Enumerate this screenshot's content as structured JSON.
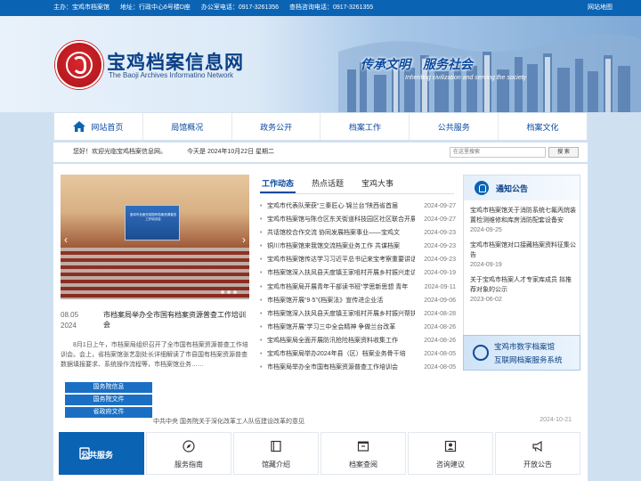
{
  "topbar": {
    "host": "主办：宝鸡市档案馆",
    "address": "地址：行政中心6号楼D座",
    "office_phone": "办公室电话：0917-3261356",
    "query_phone": "查档咨询电话：0917-3261355",
    "sitemap": "网站地图"
  },
  "header": {
    "logo_title": "宝鸡档案信息网",
    "logo_subtitle": "The Baoji Archives Informatino Network",
    "slogan": "传承文明　服务社会",
    "slogan_en": "Inheriting civilization and serving the society"
  },
  "nav": {
    "items": [
      "网站首页",
      "局馆概况",
      "政务公开",
      "档案工作",
      "公共服务",
      "档案文化"
    ]
  },
  "status": {
    "welcome": "您好！欢迎光临宝鸡档案信息网。",
    "today": "今天是 2024年10月22日 星期二",
    "search_placeholder": "在这里搜索",
    "search_button": "搜 索"
  },
  "featured": {
    "stage_text": "宝鸡市全面完成国有档案资源普查工作培训会",
    "date_md": "08.05",
    "date_year": "2024",
    "title": "市档案局举办全市国有档案资源普查工作培训会",
    "summary": "8月1日上午，市档案局组织召开了全市国有档案资源普查工作培训会。会上，省档案馆张艺副处长详细解读了市县国有档案资源普查数据填报要求、系统操作流程等，市档案馆业务……"
  },
  "quicklinks": [
    "国务院信息",
    "国务院文件",
    "省政府文件"
  ],
  "tabs": [
    "工作动态",
    "热点话题",
    "宝鸡大事"
  ],
  "news": [
    {
      "title": "宝鸡市代表队荣获“三秦匠心·锦兰台”陕西省首届",
      "date": "2024-09-27"
    },
    {
      "title": "宝鸡市档案馆与陈仓区东关街道科技园区社区联合开展",
      "date": "2024-09-27"
    },
    {
      "title": "共话馆校合作交流 协同发展档案事业——宝鸡文",
      "date": "2024-09-23"
    },
    {
      "title": "铜川市档案馆来我馆交流档案业务工作 共谋档案",
      "date": "2024-09-23"
    },
    {
      "title": "宝鸡市档案馆传达学习习近平总书记来宝考察重要讲话",
      "date": "2024-09-23"
    },
    {
      "title": "市档案馆深入扶风县天度镇王家咀村开展乡村振兴走访慰",
      "date": "2024-09-19"
    },
    {
      "title": "宝鸡市档案局开展青年干部读书班“学思新思想 青年",
      "date": "2024-09-11"
    },
    {
      "title": "市档案馆开展“9·5”《档案法》宣传进企业活",
      "date": "2024-09-06"
    },
    {
      "title": "市档案馆深入扶风县天度镇王家咀村开展乡村振兴帮扶工",
      "date": "2024-08-28"
    },
    {
      "title": "市档案馆开展“学习三中全会精神 争做兰台改革",
      "date": "2024-08-26"
    },
    {
      "title": "宝鸡档案局全面开展防汛抢险档案资料收集工作",
      "date": "2024-08-26"
    },
    {
      "title": "宝鸡市档案局举办2024年县（区）档案业务骨干培",
      "date": "2024-08-05"
    },
    {
      "title": "市档案局举办全市国有档案资源普查工作培训会",
      "date": "2024-08-05"
    }
  ],
  "notice": {
    "title": "通知公告",
    "items": [
      {
        "title": "宝鸡市档案馆关于消防系统七氟丙烷装置检测维修和库房消防配套设备安",
        "date": "2024-09-25"
      },
      {
        "title": "宝鸡市档案馆对口接藏档案资料征集公告",
        "date": "2024-09-19"
      },
      {
        "title": "关于宝鸡市档案人才专家库成员 拟推荐对象的公示",
        "date": "2023-06-02"
      }
    ]
  },
  "service_banner": {
    "line1": "宝鸡市数字档案馆",
    "line2": "互联网档案服务系统"
  },
  "ticker": {
    "title": "中共中央 国务院关于深化改革工人队伍建设改革的意见",
    "date": "2024-10-21"
  },
  "services": {
    "head": "公共服务",
    "items": [
      "服务指南",
      "馆藏介绍",
      "档案查阅",
      "咨询建议",
      "开放公告"
    ]
  },
  "colors": {
    "primary": "#0b63b4",
    "nav_text": "#0a4aa0",
    "logo_red": "#d8262c"
  }
}
